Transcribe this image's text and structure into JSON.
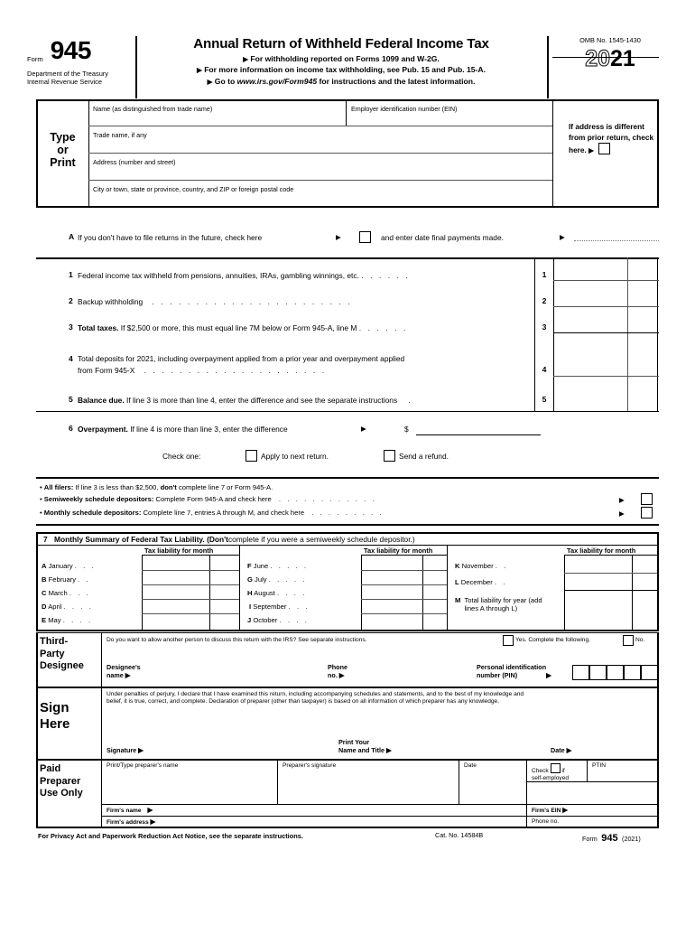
{
  "header": {
    "form_word": "Form",
    "form_number": "945",
    "dept_line1": "Department of the Treasury",
    "dept_line2": "Internal Revenue Service",
    "title": "Annual Return of Withheld Federal Income Tax",
    "sub1": "For withholding reported on Forms 1099 and W-2G.",
    "sub2": "For more information on income tax withholding, see Pub. 15 and Pub. 15-A.",
    "sub3_pre": "Go to ",
    "sub3_url": "www.irs.gov/Form945",
    "sub3_post": " for instructions and the latest information.",
    "omb": "OMB No. 1545-1430",
    "year_outline": "20",
    "year_solid": "21"
  },
  "entity": {
    "type_or_print": [
      "Type",
      "or",
      "Print"
    ],
    "name_label": "Name (as distinguished from trade name)",
    "ein_label": "Employer identification number (EIN)",
    "trade_label": "Trade name, if any",
    "address_label": "Address (number and street)",
    "city_label": "City or town, state or province, country, and ZIP or foreign postal code",
    "address_note": "If address is different from prior return, check here."
  },
  "line_a": {
    "letter": "A",
    "text": "If you don't have to file returns in the future, check here",
    "text2": "and enter date final payments made."
  },
  "lines": [
    {
      "no": "1",
      "bold": "",
      "text": "Federal income tax withheld from pensions, annuities, IRAs, gambling winnings, etc.",
      "leader": ". . . . . ."
    },
    {
      "no": "2",
      "bold": "",
      "text": "Backup withholding",
      "leader": ". . . . . . . . . . . . . . . . . . . . . . ."
    },
    {
      "no": "3",
      "bold": "Total taxes.",
      "text": "If $2,500 or more, this must equal line 7M below or Form 945-A, line M",
      "leader": ". . . . . ."
    },
    {
      "no": "4",
      "bold": "",
      "text": "Total deposits for 2021, including overpayment applied from a prior year and overpayment applied",
      "text_line2": "from Form 945-X",
      "leader": ". . . . . . . . . . . . . . . . . . . . ."
    },
    {
      "no": "5",
      "bold": "Balance due.",
      "text": "If line 3 is more than line 4, enter the difference and see the separate instructions",
      "leader": "."
    }
  ],
  "line6": {
    "no": "6",
    "bold": "Overpayment.",
    "text": "If line 4 is more than line 3, enter the difference",
    "dollar": "$",
    "check_one": "Check one:",
    "opt1": "Apply to next return.",
    "opt2": "Send a refund."
  },
  "bullets": [
    {
      "bold": "All filers:",
      "text": "If line 3 is less than $2,500,",
      "bold2": "don't",
      "text2": "complete line 7 or Form 945-A.",
      "leader": "",
      "checkbox": false
    },
    {
      "bold": "Semiweekly schedule depositors:",
      "text": "Complete Form 945-A and check here",
      "leader": ". . . . . . . . . . . .",
      "checkbox": true
    },
    {
      "bold": "Monthly schedule depositors:",
      "text": "Complete line 7, entries A through M, and check here",
      "leader": ". . . . . . . . .",
      "checkbox": true
    }
  ],
  "monthly": {
    "no": "7",
    "title_bold": "Monthly Summary of Federal Tax Liability.",
    "title_paren_bold": "(Don't",
    "title_paren_rest": "complete if you were a semiweekly schedule depositor.)",
    "col_header": "Tax liability for month",
    "col1": [
      {
        "letter": "A",
        "name": "January",
        "leader": ". . ."
      },
      {
        "letter": "B",
        "name": "February",
        "leader": ". ."
      },
      {
        "letter": "C",
        "name": "March",
        "leader": ". . ."
      },
      {
        "letter": "D",
        "name": "April",
        "leader": ". . . ."
      },
      {
        "letter": "E",
        "name": "May",
        "leader": ". . . ."
      }
    ],
    "col2": [
      {
        "letter": "F",
        "name": "June",
        "leader": ". . . . ."
      },
      {
        "letter": "G",
        "name": "July",
        "leader": ". . . . ."
      },
      {
        "letter": "H",
        "name": "August",
        "leader": ". . . ."
      },
      {
        "letter": "I",
        "name": "September",
        "leader": ". . ."
      },
      {
        "letter": "J",
        "name": "October",
        "leader": ". . . ."
      }
    ],
    "col3": [
      {
        "letter": "K",
        "name": "November",
        "leader": ". ."
      },
      {
        "letter": "L",
        "name": "December",
        "leader": ". ."
      },
      {
        "letter": "M",
        "name": "Total liability for year (add lines A through L)",
        "leader": ". ."
      }
    ]
  },
  "designee": {
    "side_label": "Third-Party Designee",
    "question": "Do you want to allow another person to discuss this return with the IRS? See separate instructions.",
    "yes": "Yes. Complete the following.",
    "no": "No.",
    "name_label1": "Designee's",
    "name_label2": "name",
    "phone_label1": "Phone",
    "phone_label2": "no.",
    "pin_label1": "Personal identification",
    "pin_label2": "number (PIN)",
    "pin_boxes": 5
  },
  "sign": {
    "side_label": "Sign Here",
    "perjury1": "Under penalties of perjury, I declare that I have examined this return, including accompanying schedules and statements, and to the best of my knowledge and",
    "perjury2": "belief, it is true, correct, and complete. Declaration of preparer (other than taxpayer) is based on all information of which preparer has any knowledge.",
    "signature": "Signature",
    "print_name1": "Print Your",
    "print_name2": "Name and Title",
    "date": "Date"
  },
  "preparer": {
    "side_label": "Paid Preparer Use Only",
    "name_label": "Print/Type preparer's name",
    "sig_label": "Preparer's signature",
    "date_label": "Date",
    "check_label1": "Check",
    "check_label2": "if",
    "check_label3": "self-employed",
    "ptin_label": "PTIN",
    "firm_name": "Firm's name",
    "firm_address": "Firm's address",
    "firm_ein": "Firm's EIN",
    "phone_no": "Phone no."
  },
  "footer": {
    "privacy": "For Privacy Act and Paperwork Reduction Act Notice, see the separate instructions.",
    "cat": "Cat. No. 14584B",
    "form_word": "Form",
    "form_no": "945",
    "year": "(2021)"
  }
}
